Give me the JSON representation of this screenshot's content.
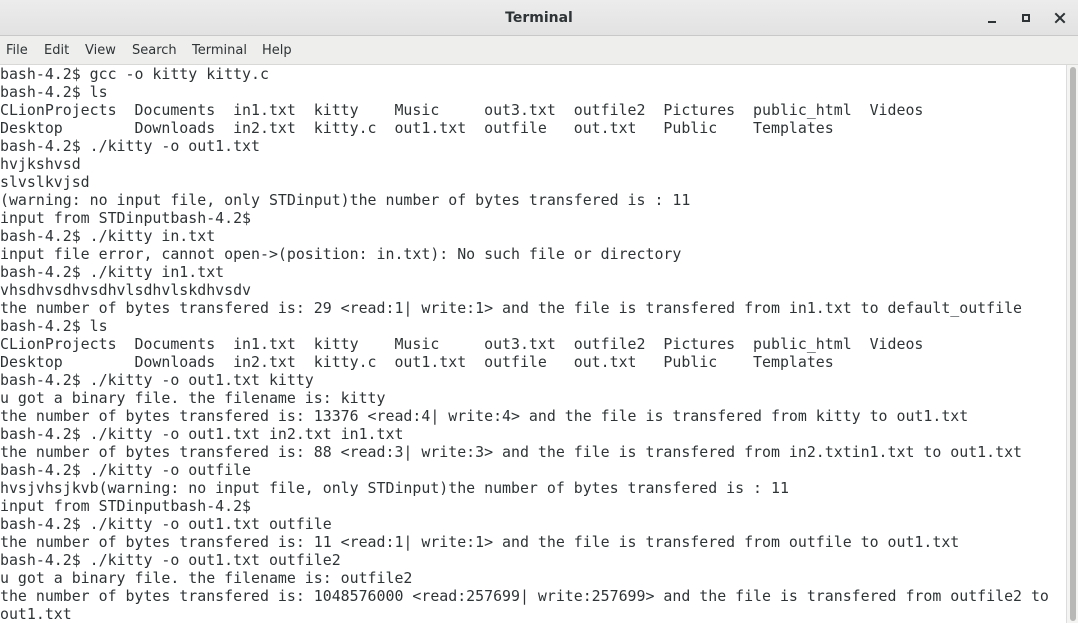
{
  "window": {
    "title": "Terminal",
    "controls": {
      "minimize_icon": "minimize-icon",
      "maximize_icon": "maximize-icon",
      "close_icon": "close-icon"
    }
  },
  "menubar": {
    "items": [
      "File",
      "Edit",
      "View",
      "Search",
      "Terminal",
      "Help"
    ]
  },
  "terminal": {
    "lines": [
      "bash-4.2$ gcc -o kitty kitty.c",
      "bash-4.2$ ls",
      "CLionProjects  Documents  in1.txt  kitty    Music     out3.txt  outfile2  Pictures  public_html  Videos",
      "Desktop        Downloads  in2.txt  kitty.c  out1.txt  outfile   out.txt   Public    Templates",
      "bash-4.2$ ./kitty -o out1.txt",
      "hvjkshvsd",
      "slvslkvjsd",
      "(warning: no input file, only STDinput)the number of bytes transfered is : 11",
      "input from STDinputbash-4.2$",
      "bash-4.2$ ./kitty in.txt",
      "input file error, cannot open->(position: in.txt): No such file or directory",
      "bash-4.2$ ./kitty in1.txt",
      "vhsdhvsdhvsdhvlsdhvlskdhvsdv",
      "the number of bytes transfered is: 29 <read:1| write:1> and the file is transfered from in1.txt to default_outfile",
      "bash-4.2$ ls",
      "CLionProjects  Documents  in1.txt  kitty    Music     out3.txt  outfile2  Pictures  public_html  Videos",
      "Desktop        Downloads  in2.txt  kitty.c  out1.txt  outfile   out.txt   Public    Templates",
      "bash-4.2$ ./kitty -o out1.txt kitty",
      "u got a binary file. the filename is: kitty",
      "the number of bytes transfered is: 13376 <read:4| write:4> and the file is transfered from kitty to out1.txt",
      "bash-4.2$ ./kitty -o out1.txt in2.txt in1.txt",
      "the number of bytes transfered is: 88 <read:3| write:3> and the file is transfered from in2.txtin1.txt to out1.txt",
      "bash-4.2$ ./kitty -o outfile",
      "hvsjvhsjkvb(warning: no input file, only STDinput)the number of bytes transfered is : 11",
      "input from STDinputbash-4.2$",
      "bash-4.2$ ./kitty -o out1.txt outfile",
      "the number of bytes transfered is: 11 <read:1| write:1> and the file is transfered from outfile to out1.txt",
      "bash-4.2$ ./kitty -o out1.txt outfile2",
      "u got a binary file. the filename is: outfile2",
      "the number of bytes transfered is: 1048576000 <read:257699| write:257699> and the file is transfered from outfile2 to",
      "out1.txt"
    ]
  }
}
